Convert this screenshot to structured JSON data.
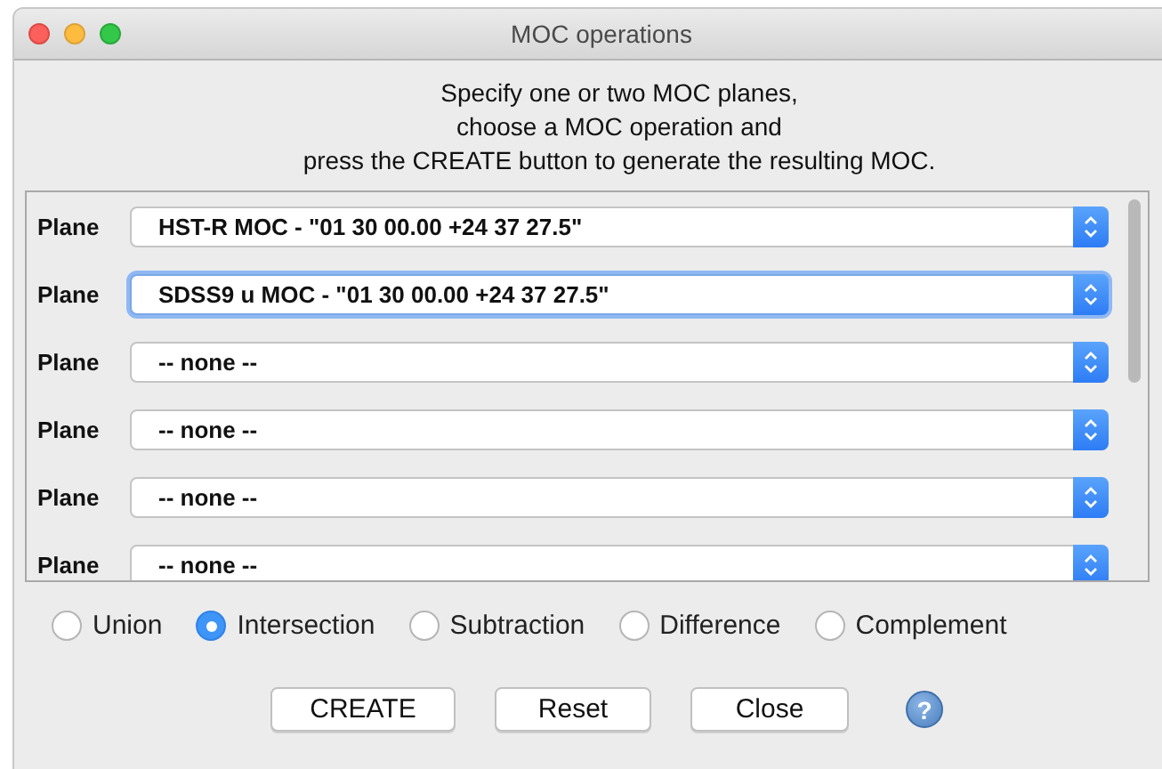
{
  "window": {
    "title": "MOC operations"
  },
  "instructions": [
    "Specify one or two MOC planes,",
    "choose a MOC operation and",
    "press the CREATE button to generate the resulting MOC."
  ],
  "planes": [
    {
      "label": "Plane",
      "value": "HST-R MOC - \"01 30 00.00 +24 37 27.5\"",
      "focused": false
    },
    {
      "label": "Plane",
      "value": "SDSS9 u MOC - \"01 30 00.00 +24 37 27.5\"",
      "focused": true
    },
    {
      "label": "Plane",
      "value": "-- none --",
      "focused": false
    },
    {
      "label": "Plane",
      "value": "-- none --",
      "focused": false
    },
    {
      "label": "Plane",
      "value": "-- none --",
      "focused": false
    },
    {
      "label": "Plane",
      "value": "-- none --",
      "focused": false
    }
  ],
  "operations": [
    {
      "label": "Union",
      "selected": false
    },
    {
      "label": "Intersection",
      "selected": true
    },
    {
      "label": "Subtraction",
      "selected": false
    },
    {
      "label": "Difference",
      "selected": false
    },
    {
      "label": "Complement",
      "selected": false
    }
  ],
  "buttons": [
    "CREATE",
    "Reset",
    "Close"
  ],
  "help": {
    "label": "?"
  }
}
